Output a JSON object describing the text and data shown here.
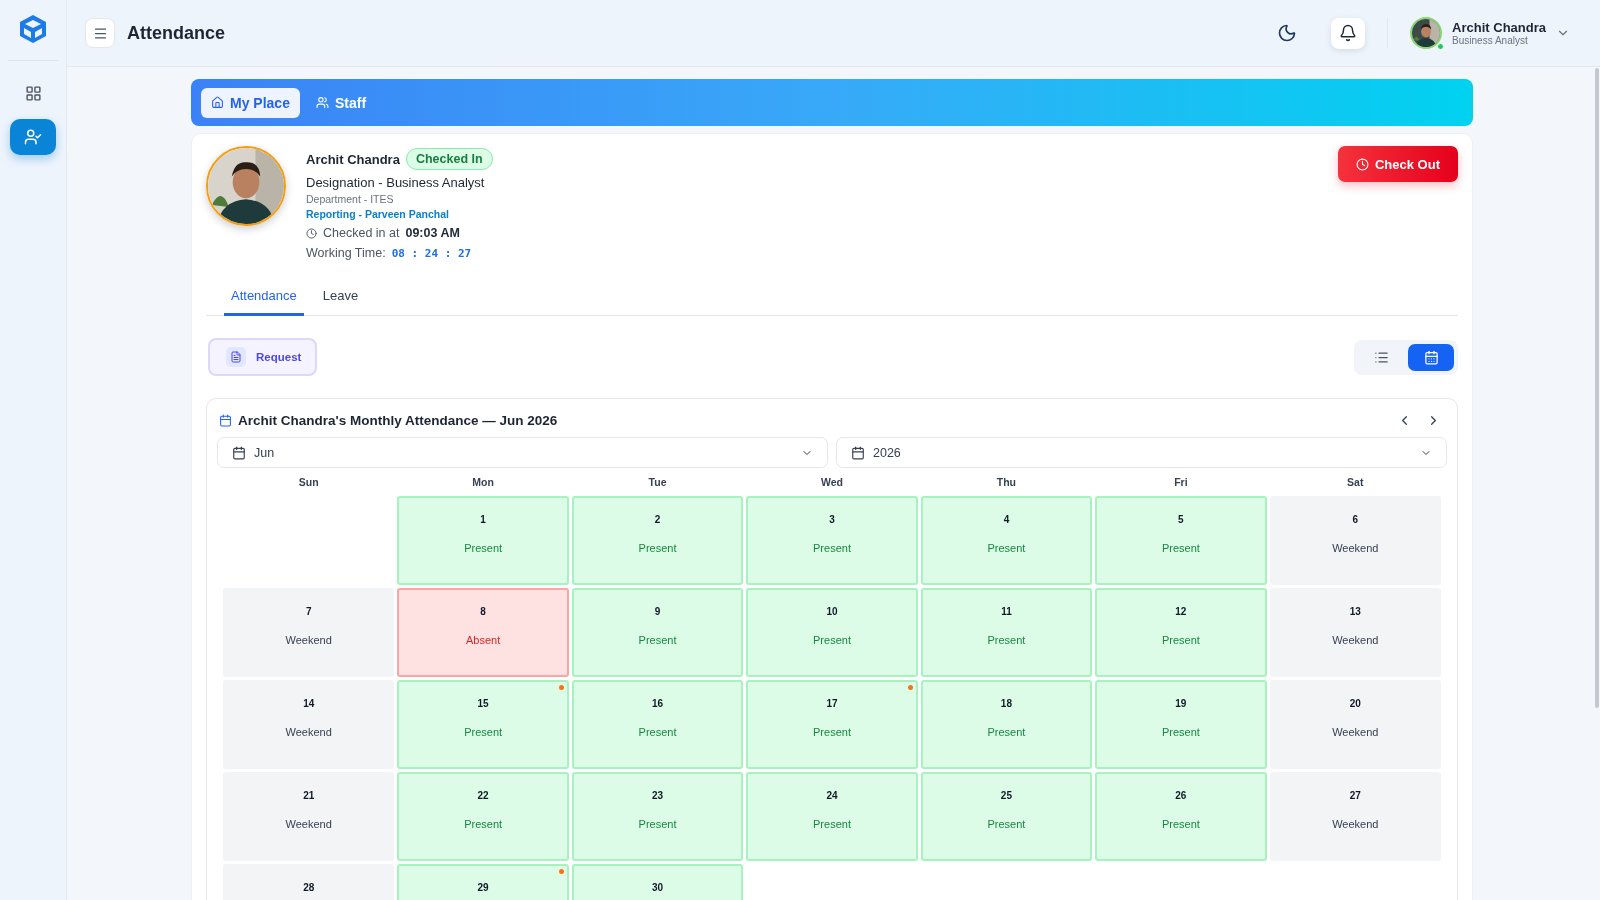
{
  "sidebar": {
    "items": [
      {
        "kind": "grid",
        "selected": false
      },
      {
        "kind": "user-check",
        "selected": true
      }
    ]
  },
  "header": {
    "title": "Attendance",
    "user": {
      "name": "Archit Chandra",
      "role": "Business Analyst",
      "online": true
    }
  },
  "top_tabs": [
    {
      "label": "My Place",
      "kind": "home",
      "selected": true
    },
    {
      "label": "Staff",
      "kind": "users",
      "selected": false
    }
  ],
  "profile": {
    "name": "Archit Chandra",
    "status": "Checked In",
    "designation": "Designation - Business Analyst",
    "department": "Department - ITES",
    "reporting": "Reporting - Parveen Panchal",
    "checked_in_label": "Checked in at",
    "checked_in_time": "09:03 AM",
    "working_label": "Working Time:",
    "working_time": "08 : 24 : 27",
    "action": "Check Out"
  },
  "tabs": [
    {
      "label": "Attendance",
      "selected": true
    },
    {
      "label": "Leave",
      "selected": false
    }
  ],
  "request_button": "Request",
  "view_toggle": [
    {
      "kind": "list",
      "selected": false
    },
    {
      "kind": "calendar",
      "selected": true
    }
  ],
  "calendar": {
    "title": "Archit Chandra's Monthly Attendance — Jun 2026",
    "month": "Jun",
    "year": "2026",
    "weekdays": [
      "Sun",
      "Mon",
      "Tue",
      "Wed",
      "Thu",
      "Fri",
      "Sat"
    ],
    "weeks": [
      [
        {
          "kind": "empty"
        },
        {
          "day": "1",
          "kind": "present",
          "status": "Present",
          "flag": false
        },
        {
          "day": "2",
          "kind": "present",
          "status": "Present",
          "flag": false
        },
        {
          "day": "3",
          "kind": "present",
          "status": "Present",
          "flag": false
        },
        {
          "day": "4",
          "kind": "present",
          "status": "Present",
          "flag": false
        },
        {
          "day": "5",
          "kind": "present",
          "status": "Present",
          "flag": false
        },
        {
          "day": "6",
          "kind": "weekend",
          "status": "Weekend",
          "flag": false
        }
      ],
      [
        {
          "day": "7",
          "kind": "weekend",
          "status": "Weekend",
          "flag": false
        },
        {
          "day": "8",
          "kind": "absent",
          "status": "Absent",
          "flag": false
        },
        {
          "day": "9",
          "kind": "present",
          "status": "Present",
          "flag": false
        },
        {
          "day": "10",
          "kind": "present",
          "status": "Present",
          "flag": false
        },
        {
          "day": "11",
          "kind": "present",
          "status": "Present",
          "flag": false
        },
        {
          "day": "12",
          "kind": "present",
          "status": "Present",
          "flag": false
        },
        {
          "day": "13",
          "kind": "weekend",
          "status": "Weekend",
          "flag": false
        }
      ],
      [
        {
          "day": "14",
          "kind": "weekend",
          "status": "Weekend",
          "flag": false
        },
        {
          "day": "15",
          "kind": "present",
          "status": "Present",
          "flag": true
        },
        {
          "day": "16",
          "kind": "present",
          "status": "Present",
          "flag": false
        },
        {
          "day": "17",
          "kind": "present",
          "status": "Present",
          "flag": true
        },
        {
          "day": "18",
          "kind": "present",
          "status": "Present",
          "flag": false
        },
        {
          "day": "19",
          "kind": "present",
          "status": "Present",
          "flag": false
        },
        {
          "day": "20",
          "kind": "weekend",
          "status": "Weekend",
          "flag": false
        }
      ],
      [
        {
          "day": "21",
          "kind": "weekend",
          "status": "Weekend",
          "flag": false
        },
        {
          "day": "22",
          "kind": "present",
          "status": "Present",
          "flag": false
        },
        {
          "day": "23",
          "kind": "present",
          "status": "Present",
          "flag": false
        },
        {
          "day": "24",
          "kind": "present",
          "status": "Present",
          "flag": false
        },
        {
          "day": "25",
          "kind": "present",
          "status": "Present",
          "flag": false
        },
        {
          "day": "26",
          "kind": "present",
          "status": "Present",
          "flag": false
        },
        {
          "day": "27",
          "kind": "weekend",
          "status": "Weekend",
          "flag": false
        }
      ],
      [
        {
          "day": "28",
          "kind": "weekend",
          "flag": false
        },
        {
          "day": "29",
          "kind": "present",
          "flag": true
        },
        {
          "day": "30",
          "kind": "present",
          "flag": false
        }
      ]
    ]
  }
}
